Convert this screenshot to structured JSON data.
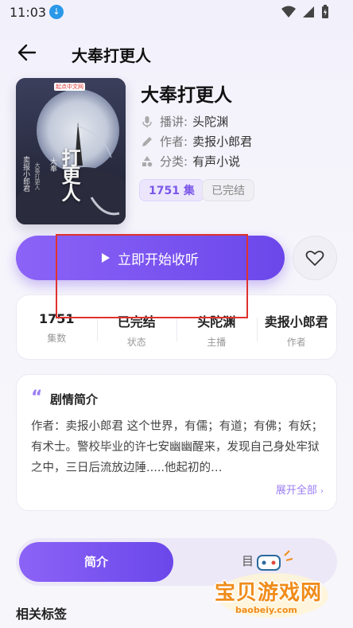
{
  "status_bar": {
    "time": "11:03"
  },
  "header": {
    "title": "大奉打更人"
  },
  "book": {
    "title": "大奉打更人",
    "narrator_label": "播讲:",
    "narrator": "头陀渊",
    "author_label": "作者:",
    "author": "卖报小郎君",
    "category_label": "分类:",
    "category": "有声小说",
    "episodes_tag": "1751 集",
    "status_tag": "已完结",
    "cover": {
      "publisher": "起点中文网",
      "title_big": "打更人",
      "title_small": "大奉",
      "author_vertical": "卖报小郎君",
      "subtitle_vertical": "大奉打更人"
    }
  },
  "actions": {
    "play_label": "立即开始收听"
  },
  "stats": [
    {
      "value": "1751",
      "label": "集数"
    },
    {
      "value": "已完结",
      "label": "状态"
    },
    {
      "value": "头陀渊",
      "label": "主播"
    },
    {
      "value": "卖报小郎君",
      "label": "作者"
    }
  ],
  "intro": {
    "heading": "剧情简介",
    "text": "作者：卖报小郎君 这个世界，有儒；有道；有佛；有妖；有术士。警校毕业的许七安幽幽醒来，发现自己身处牢狱之中，三日后流放边陲.....他起初的…",
    "expand_label": "展开全部"
  },
  "tabs": {
    "active": "简介",
    "other": "目"
  },
  "section": {
    "related_title": "相关标签"
  },
  "watermark": {
    "text": "宝贝游戏网",
    "url": "baobeiy.com"
  },
  "colors": {
    "accent": "#7a57e8",
    "highlight": "#e0322e"
  }
}
